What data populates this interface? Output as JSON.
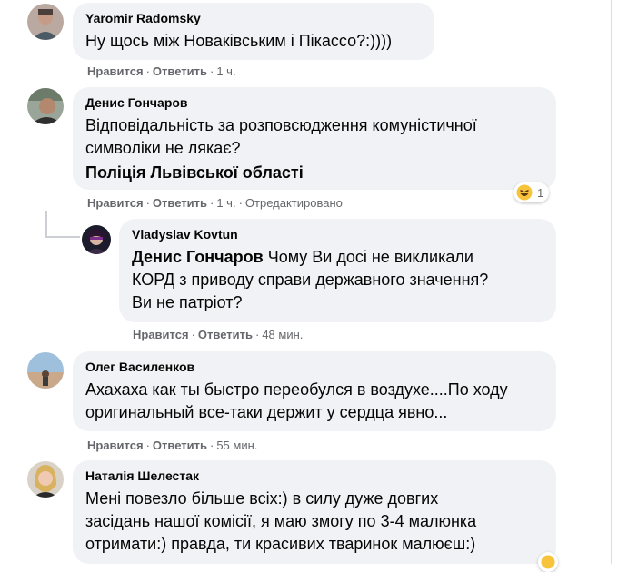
{
  "comments": [
    {
      "author": "Yaromir Radomsky",
      "lines": [
        "Ну щось між Новаківським і Пікассо?:))))"
      ],
      "actions": {
        "like": "Нравится",
        "reply": "Ответить",
        "time": "1 ч."
      }
    },
    {
      "author": "Денис Гончаров",
      "lines": [
        "Відповідальність за розповсюдження комуністичної",
        "символіки не лякає?"
      ],
      "tag": "Поліція Львівської області",
      "actions": {
        "like": "Нравится",
        "reply": "Ответить",
        "time": "1 ч.",
        "edited": "Отредактировано"
      },
      "reaction": {
        "icon": "haha-emoji-icon",
        "count": "1"
      }
    },
    {
      "author": "Vladyslav Kovtun",
      "mention": "Денис Гончаров",
      "lines": [
        " Чому Ви досі не викликали",
        "КОРД з приводу справи державного значення?",
        "Ви не патріот?"
      ],
      "actions": {
        "like": "Нравится",
        "reply": "Ответить",
        "time": "48 мин."
      }
    },
    {
      "author": "Олег Василенков",
      "lines": [
        "Ахахаха как ты быстро переобулся в воздухе....По ходу",
        "оригинальный все-таки держит у сердца явно..."
      ],
      "actions": {
        "like": "Нравится",
        "reply": "Ответить",
        "time": "55 мин."
      }
    },
    {
      "author": "Наталія Шелестак",
      "lines": [
        "Мені повезло більше всіх:) в силу дуже довгих",
        "засідань нашої комісії, я маю змогу по 3-4 малюнка",
        "отримати:) правда, ти красивих тваринок малюєш:)"
      ]
    }
  ],
  "colors": {
    "bubble": "#f0f2f5",
    "meta": "#65676b",
    "text": "#050505"
  }
}
